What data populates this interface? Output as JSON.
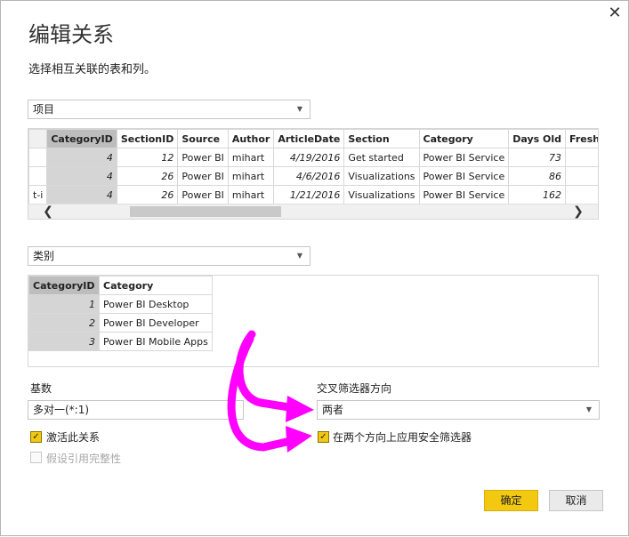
{
  "dialog": {
    "title": "编辑关系",
    "subtitle": "选择相互关联的表和列。",
    "close_icon": "close-icon"
  },
  "table1": {
    "select_value": "项目",
    "columns": [
      "",
      "CategoryID",
      "SectionID",
      "Source",
      "Author",
      "ArticleDate",
      "Section",
      "Category",
      "Days Old",
      "Fresh"
    ],
    "rows": [
      [
        "",
        "4",
        "12",
        "Power BI",
        "mihart",
        "4/19/2016",
        "Get started",
        "Power BI Service",
        "73",
        ""
      ],
      [
        "",
        "4",
        "26",
        "Power BI",
        "mihart",
        "4/6/2016",
        "Visualizations",
        "Power BI Service",
        "86",
        ""
      ],
      [
        "t-i",
        "4",
        "26",
        "Power BI",
        "mihart",
        "1/21/2016",
        "Visualizations",
        "Power BI Service",
        "162",
        ""
      ]
    ]
  },
  "table2": {
    "select_value": "类别",
    "columns": [
      "CategoryID",
      "Category"
    ],
    "rows": [
      [
        "1",
        "Power BI Desktop"
      ],
      [
        "2",
        "Power BI Developer"
      ],
      [
        "3",
        "Power BI Mobile Apps"
      ]
    ]
  },
  "cardinality": {
    "label": "基数",
    "value": "多对一(*:1)"
  },
  "cross_filter": {
    "label": "交叉筛选器方向",
    "value": "两者"
  },
  "checks": {
    "active": {
      "label": "激活此关系",
      "checked": true
    },
    "referential": {
      "label": "假设引用完整性",
      "checked": false
    },
    "security": {
      "label": "在两个方向上应用安全筛选器",
      "checked": true
    }
  },
  "buttons": {
    "ok": "确定",
    "cancel": "取消"
  },
  "colors": {
    "accent": "#f2c811",
    "arrow": "#ff00ff"
  }
}
